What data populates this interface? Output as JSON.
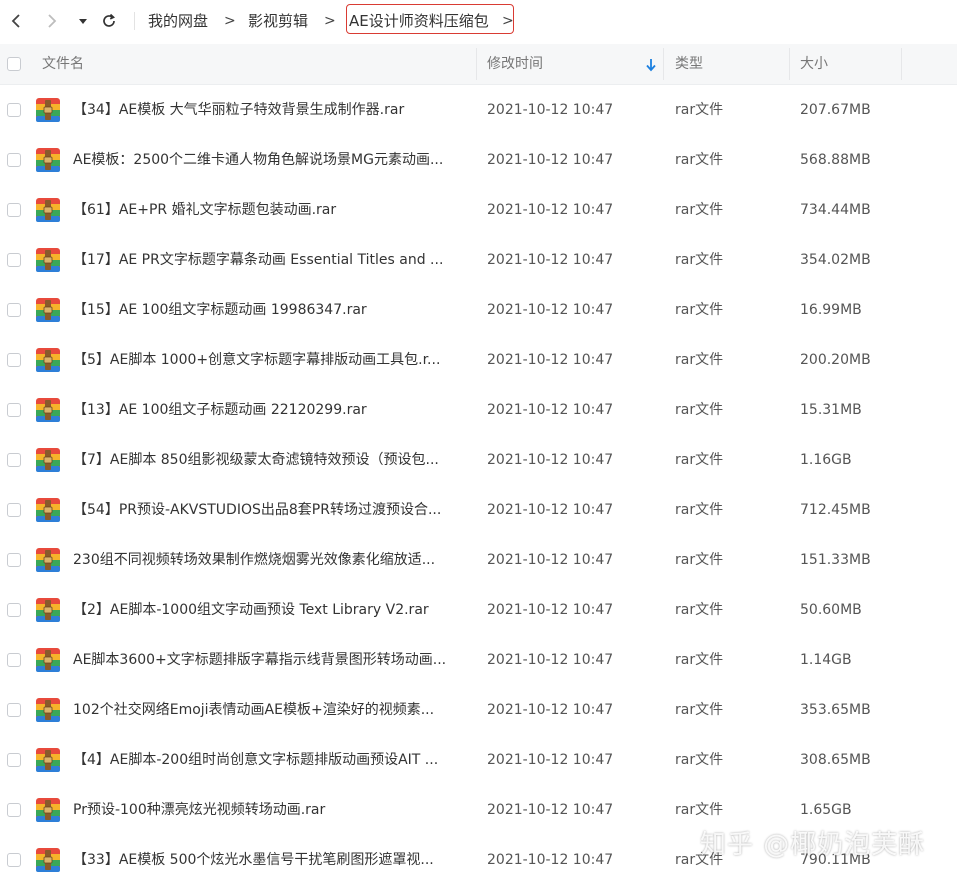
{
  "toolbar": {
    "icons": [
      "back-icon",
      "forward-icon",
      "dropdown-icon",
      "refresh-icon"
    ],
    "breadcrumb": [
      {
        "label": "我的网盘"
      },
      {
        "label": "影视剪辑"
      },
      {
        "label": "AE设计师资料压缩包"
      }
    ],
    "separator": ">"
  },
  "table": {
    "columns": {
      "name": "文件名",
      "modified": "修改时间",
      "type": "类型",
      "size": "大小"
    },
    "sort": {
      "column": "修改时间",
      "direction": "descending"
    },
    "rows": [
      {
        "name": "【34】AE模板 大气华丽粒子特效背景生成制作器.rar",
        "time": "2021-10-12 10:47",
        "type": "rar文件",
        "size": "207.67MB"
      },
      {
        "name": "AE模板：2500个二维卡通人物角色解说场景MG元素动画...",
        "time": "2021-10-12 10:47",
        "type": "rar文件",
        "size": "568.88MB"
      },
      {
        "name": "【61】AE+PR 婚礼文字标题包装动画.rar",
        "time": "2021-10-12 10:47",
        "type": "rar文件",
        "size": "734.44MB"
      },
      {
        "name": "【17】AE PR文字标题字幕条动画 Essential Titles and ...",
        "time": "2021-10-12 10:47",
        "type": "rar文件",
        "size": "354.02MB"
      },
      {
        "name": "【15】AE 100组文字标题动画 19986347.rar",
        "time": "2021-10-12 10:47",
        "type": "rar文件",
        "size": "16.99MB"
      },
      {
        "name": "【5】AE脚本  1000+创意文字标题字幕排版动画工具包.r...",
        "time": "2021-10-12 10:47",
        "type": "rar文件",
        "size": "200.20MB"
      },
      {
        "name": "【13】AE 100组文子标题动画 22120299.rar",
        "time": "2021-10-12 10:47",
        "type": "rar文件",
        "size": "15.31MB"
      },
      {
        "name": "【7】AE脚本 850组影视级蒙太奇滤镜特效预设（预设包...",
        "time": "2021-10-12 10:47",
        "type": "rar文件",
        "size": "1.16GB"
      },
      {
        "name": "【54】PR预设-AKVSTUDIOS出品8套PR转场过渡预设合...",
        "time": "2021-10-12 10:47",
        "type": "rar文件",
        "size": "712.45MB"
      },
      {
        "name": "230组不同视频转场效果制作燃烧烟雾光效像素化缩放适...",
        "time": "2021-10-12 10:47",
        "type": "rar文件",
        "size": "151.33MB"
      },
      {
        "name": "【2】AE脚本-1000组文字动画预设 Text Library V2.rar",
        "time": "2021-10-12 10:47",
        "type": "rar文件",
        "size": "50.60MB"
      },
      {
        "name": "AE脚本3600+文字标题排版字幕指示线背景图形转场动画...",
        "time": "2021-10-12 10:47",
        "type": "rar文件",
        "size": "1.14GB"
      },
      {
        "name": "102个社交网络Emoji表情动画AE模板+渲染好的视频素...",
        "time": "2021-10-12 10:47",
        "type": "rar文件",
        "size": "353.65MB"
      },
      {
        "name": "【4】AE脚本-200组时尚创意文字标题排版动画预设AIT  ...",
        "time": "2021-10-12 10:47",
        "type": "rar文件",
        "size": "308.65MB"
      },
      {
        "name": "Pr预设-100种漂亮炫光视频转场动画.rar",
        "time": "2021-10-12 10:47",
        "type": "rar文件",
        "size": "1.65GB"
      },
      {
        "name": "【33】AE模板 500个炫光水墨信号干扰笔刷图形遮罩视...",
        "time": "2021-10-12 10:47",
        "type": "rar文件",
        "size": "790.11MB"
      }
    ]
  },
  "watermark": "知乎 @椰奶泡芙酥",
  "colors": {
    "accent": "#1b7fe0",
    "breadcrumb_highlight": "#d93b33",
    "header_bg": "#f6f7f8"
  },
  "file_icon": "rar-archive-icon"
}
